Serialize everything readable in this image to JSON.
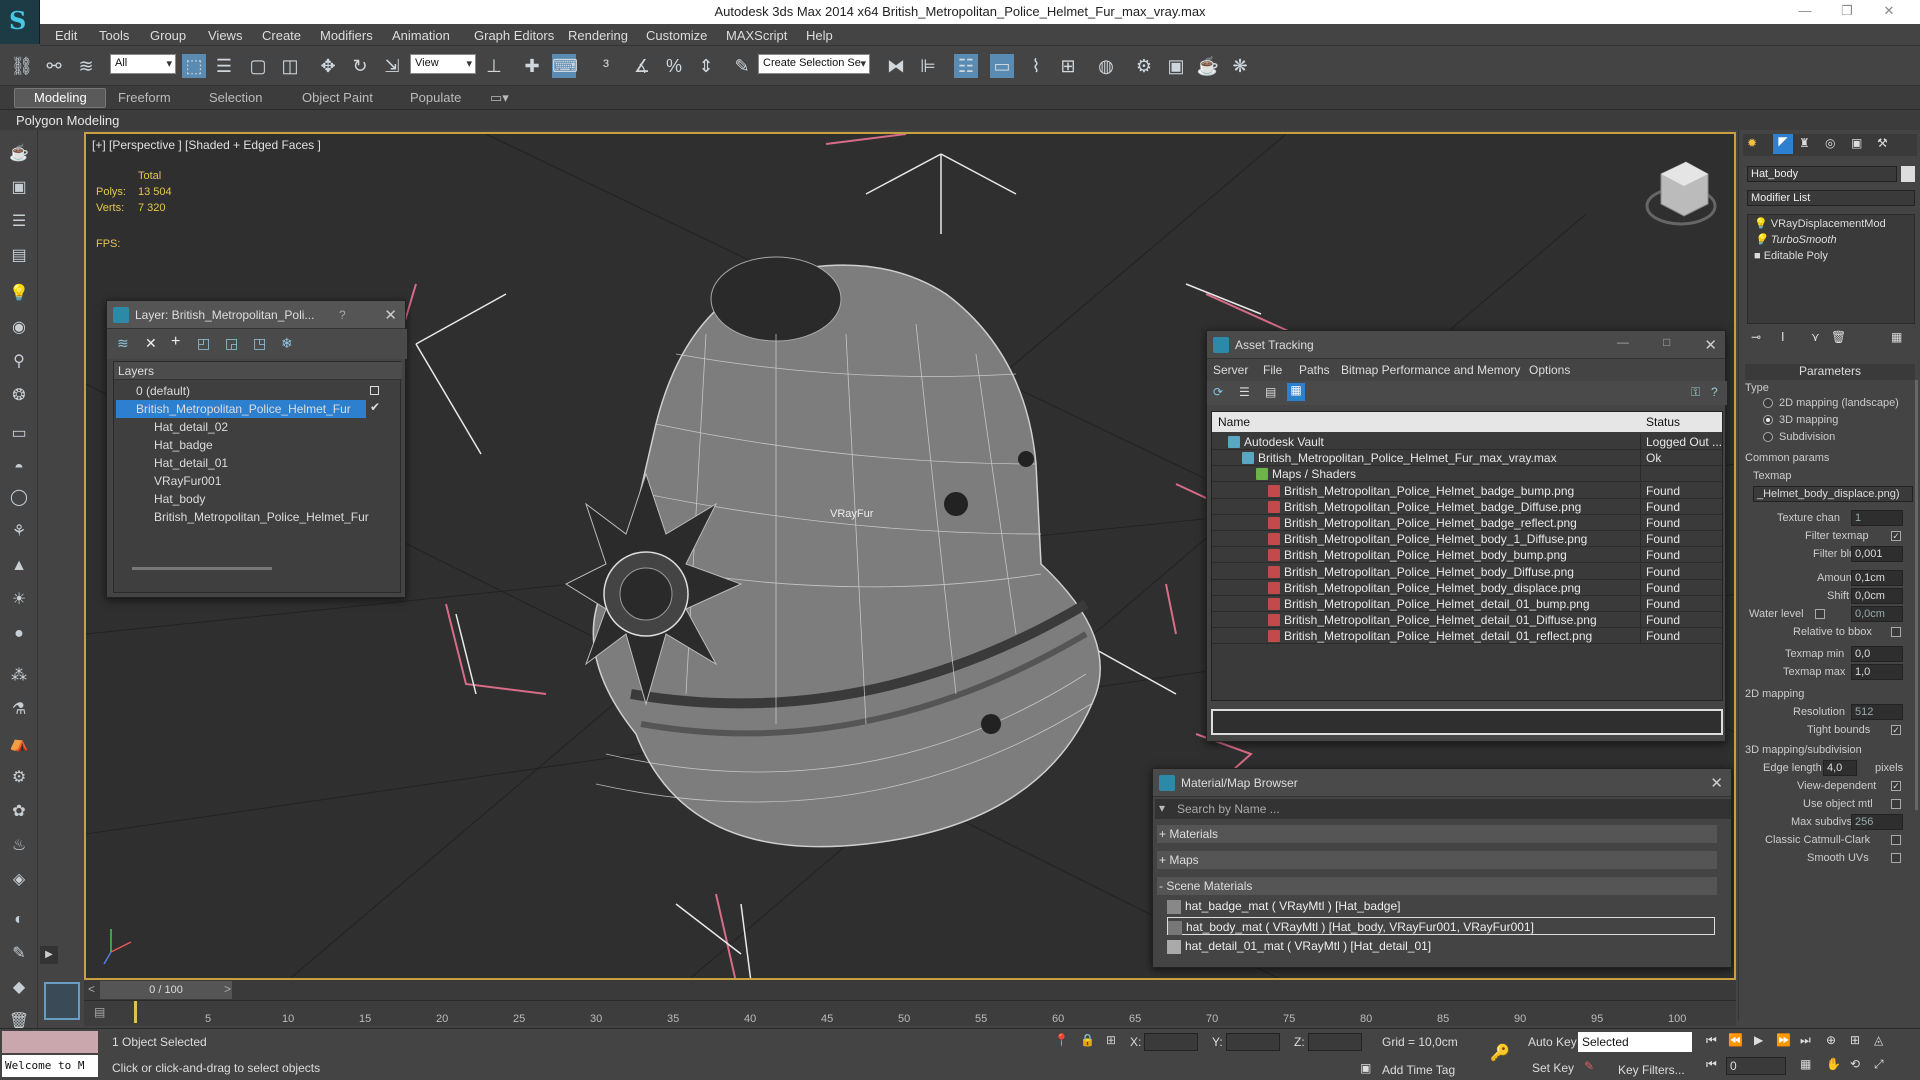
{
  "window": {
    "title": "Autodesk 3ds Max  2014 x64    British_Metropolitan_Police_Helmet_Fur_max_vray.max"
  },
  "menu": [
    "Edit",
    "Tools",
    "Group",
    "Views",
    "Create",
    "Modifiers",
    "Animation",
    "Graph Editors",
    "Rendering",
    "Customize",
    "MAXScript",
    "Help"
  ],
  "toolbar": {
    "filter": "All",
    "refcoord": "View",
    "selset": "Create Selection Se"
  },
  "ribbon": {
    "tabs": [
      "Modeling",
      "Freeform",
      "Selection",
      "Object Paint",
      "Populate"
    ],
    "active": "Modeling",
    "sub": "Polygon Modeling"
  },
  "viewport": {
    "label": "[+] [Perspective ] [Shaded + Edged Faces ]",
    "stats": {
      "total": "Total",
      "polys_label": "Polys:",
      "polys": "13 504",
      "verts_label": "Verts:",
      "verts": "7 320",
      "fps_label": "FPS:"
    },
    "vrayfur_label": "VRayFur"
  },
  "layer_window": {
    "title": "Layer: British_Metropolitan_Poli...",
    "help": "?",
    "header": "Layers",
    "items": [
      "0 (default)",
      "British_Metropolitan_Police_Helmet_Fur",
      "Hat_detail_02",
      "Hat_badge",
      "Hat_detail_01",
      "VRayFur001",
      "Hat_body",
      "British_Metropolitan_Police_Helmet_Fur"
    ]
  },
  "asset_tracking": {
    "title": "Asset Tracking",
    "menu": [
      "Server",
      "File",
      "Paths",
      "Bitmap Performance and Memory",
      "Options"
    ],
    "col_name": "Name",
    "col_status": "Status",
    "rows": [
      {
        "name": "Autodesk Vault",
        "status": "Logged Out ..."
      },
      {
        "name": "British_Metropolitan_Police_Helmet_Fur_max_vray.max",
        "status": "Ok"
      },
      {
        "name": "Maps / Shaders",
        "status": ""
      },
      {
        "name": "British_Metropolitan_Police_Helmet_badge_bump.png",
        "status": "Found"
      },
      {
        "name": "British_Metropolitan_Police_Helmet_badge_Diffuse.png",
        "status": "Found"
      },
      {
        "name": "British_Metropolitan_Police_Helmet_badge_reflect.png",
        "status": "Found"
      },
      {
        "name": "British_Metropolitan_Police_Helmet_body_1_Diffuse.png",
        "status": "Found"
      },
      {
        "name": "British_Metropolitan_Police_Helmet_body_bump.png",
        "status": "Found"
      },
      {
        "name": "British_Metropolitan_Police_Helmet_body_Diffuse.png",
        "status": "Found"
      },
      {
        "name": "British_Metropolitan_Police_Helmet_body_displace.png",
        "status": "Found"
      },
      {
        "name": "British_Metropolitan_Police_Helmet_detail_01_bump.png",
        "status": "Found"
      },
      {
        "name": "British_Metropolitan_Police_Helmet_detail_01_Diffuse.png",
        "status": "Found"
      },
      {
        "name": "British_Metropolitan_Police_Helmet_detail_01_reflect.png",
        "status": "Found"
      }
    ]
  },
  "material_browser": {
    "title": "Material/Map Browser",
    "search_placeholder": "Search by Name ...",
    "sections": [
      "+ Materials",
      "+ Maps",
      "- Scene Materials"
    ],
    "materials": [
      "hat_badge_mat ( VRayMtl ) [Hat_badge]",
      "hat_body_mat ( VRayMtl ) [Hat_body, VRayFur001, VRayFur001]",
      "hat_detail_01_mat ( VRayMtl ) [Hat_detail_01]"
    ]
  },
  "command_panel": {
    "object_name": "Hat_body",
    "modifier_list": "Modifier List",
    "stack": [
      "VRayDisplacementMod",
      "TurboSmooth",
      "Editable Poly"
    ],
    "parameters": "Parameters",
    "type_label": "Type",
    "types": [
      "2D mapping (landscape)",
      "3D mapping",
      "Subdivision"
    ],
    "common_params": "Common params",
    "texmap_label": "Texmap",
    "texmap": "_Helmet_body_displace.png)",
    "texture_chan_label": "Texture chan",
    "texture_chan": "1",
    "filter_texmap": "Filter texmap",
    "filter_blur_label": "Filter blur",
    "filter_blur": "0,001",
    "amount_label": "Amount",
    "amount": "0,1cm",
    "shift_label": "Shift",
    "shift": "0,0cm",
    "water_level_label": "Water level",
    "water_level": "0,0cm",
    "relative_bbox": "Relative to bbox",
    "texmap_min_label": "Texmap min",
    "texmap_min": "0,0",
    "texmap_max_label": "Texmap max",
    "texmap_max": "1,0",
    "mapping2d": "2D mapping",
    "resolution_label": "Resolution",
    "resolution": "512",
    "tight_bounds": "Tight bounds",
    "mapping3d": "3D mapping/subdivision",
    "edge_length_label": "Edge length",
    "edge_length": "4,0",
    "pixels": "pixels",
    "view_dependent": "View-dependent",
    "use_object_mtl": "Use object mtl",
    "max_subdivs_label": "Max subdivs",
    "max_subdivs": "256",
    "classic_catmull": "Classic Catmull-Clark",
    "smooth_uvs": "Smooth UVs"
  },
  "timeline": {
    "frame": "0 / 100",
    "ticks": [
      "5",
      "10",
      "15",
      "20",
      "25",
      "30",
      "35",
      "40",
      "45",
      "50",
      "55",
      "60",
      "65",
      "70",
      "75",
      "80",
      "85",
      "90",
      "95",
      "100"
    ]
  },
  "status": {
    "welcome": "Welcome to M",
    "selected": "1 Object Selected",
    "prompt": "Click or click-and-drag to select objects",
    "x_label": "X:",
    "y_label": "Y:",
    "z_label": "Z:",
    "grid": "Grid = 10,0cm",
    "auto_key": "Auto Key",
    "set_key": "Set Key",
    "selected_mode": "Selected",
    "key_filters": "Key Filters...",
    "add_time_tag": "Add Time Tag",
    "frame_value": "0"
  }
}
